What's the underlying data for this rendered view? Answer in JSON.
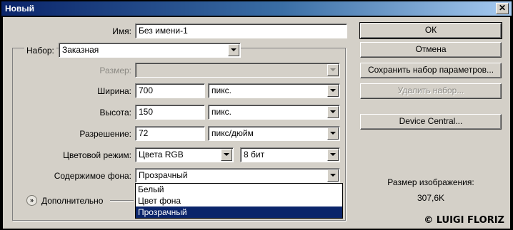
{
  "window": {
    "title": "Новый",
    "close_glyph": "✕"
  },
  "form": {
    "name_label": "Имя:",
    "name_value": "Без имени-1",
    "preset_label": "Набор:",
    "preset_value": "Заказная",
    "size_label": "Размер:",
    "size_value": "",
    "width_label": "Ширина:",
    "width_value": "700",
    "width_unit": "пикс.",
    "height_label": "Высота:",
    "height_value": "150",
    "height_unit": "пикс.",
    "resolution_label": "Разрешение:",
    "resolution_value": "72",
    "resolution_unit": "пикс/дюйм",
    "color_mode_label": "Цветовой режим:",
    "color_mode_value": "Цвета RGB",
    "bit_depth_value": "8 бит",
    "background_label": "Содержимое фона:",
    "background_value": "Прозрачный",
    "background_options": [
      "Белый",
      "Цвет фона",
      "Прозрачный"
    ],
    "background_selected_index": 2,
    "advanced_label": "Дополнительно",
    "advanced_glyph": "»"
  },
  "buttons": {
    "ok": "ОК",
    "cancel": "Отмена",
    "save_preset": "Сохранить набор параметров...",
    "delete_preset": "Удалить набор...",
    "device_central": "Device Central..."
  },
  "info": {
    "image_size_label": "Размер изображения:",
    "image_size_value": "307,6K"
  },
  "watermark": "© LUIGI FLORIZ",
  "colors": {
    "title_start": "#0a246a",
    "title_end": "#a6caf0",
    "face": "#d4d0c8",
    "selection": "#0a246a"
  }
}
